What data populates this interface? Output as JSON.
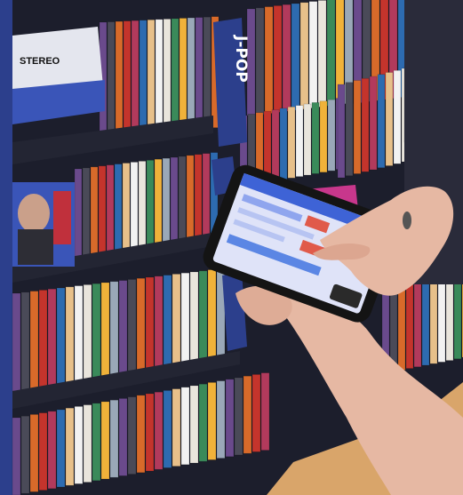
{
  "scene": {
    "shelf_label_text": "J-POP",
    "box_label_text": "STEREO"
  },
  "colors": {
    "shelf_blue": "#2c3f8c",
    "background_dark": "#1c1e2c",
    "phone_screen": "#dfe3f8",
    "phone_header": "#3e63d6",
    "hand_skin": "#e6b8a3",
    "magenta_box": "#c8378c",
    "floor_wood": "#d9a56a"
  },
  "icons": [
    "smartphone-icon"
  ]
}
